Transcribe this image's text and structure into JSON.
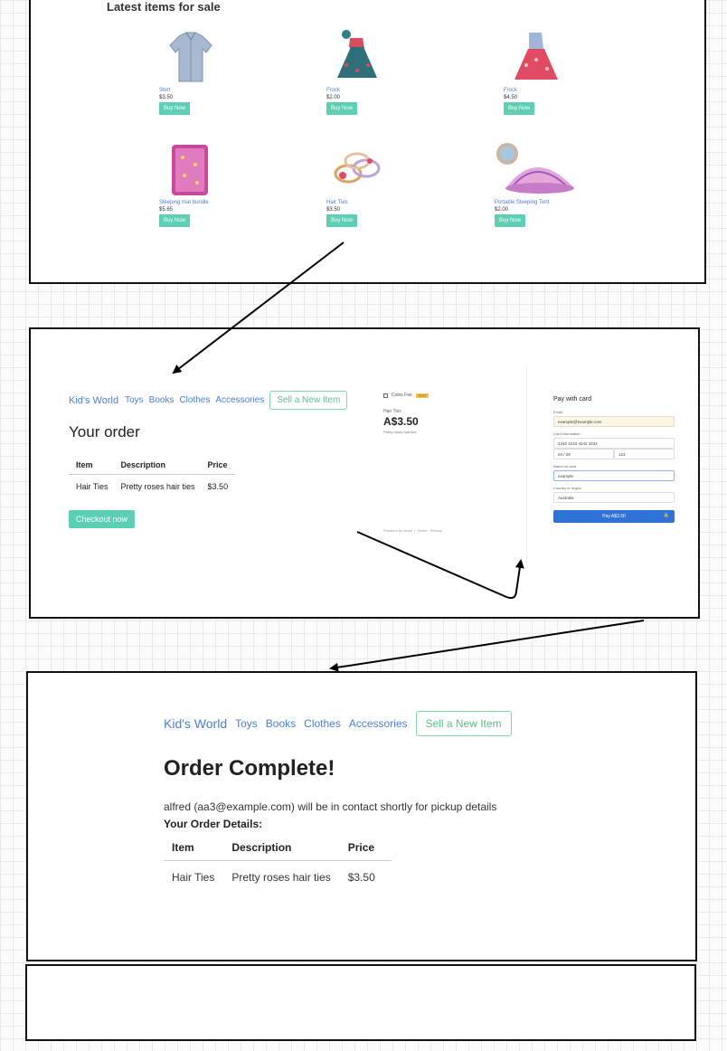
{
  "panel1": {
    "title": "Latest items for sale",
    "products": [
      {
        "name": "Shirt",
        "price": "$3.50",
        "button": "Buy Now"
      },
      {
        "name": "Frock",
        "price": "$2.00",
        "button": "Buy Now"
      },
      {
        "name": "Frock",
        "price": "$4.50",
        "button": "Buy Now"
      },
      {
        "name": "Sleeping mat bundle",
        "price": "$5.65",
        "button": "Buy Now"
      },
      {
        "name": "Hair Ties",
        "price": "$3.50",
        "button": "Buy Now"
      },
      {
        "name": "Portable Sleeping Tent",
        "price": "$2.00",
        "button": "Buy Now"
      }
    ]
  },
  "panel2": {
    "nav": {
      "brand": "Kid's World",
      "links": [
        "Toys",
        "Books",
        "Clothes",
        "Accessories"
      ],
      "sell": "Sell a New Item"
    },
    "title": "Your order",
    "table": {
      "headers": [
        "Item",
        "Description",
        "Price"
      ],
      "rows": [
        [
          "Hair Ties",
          "Pretty roses hair ties",
          "$3.50"
        ]
      ]
    },
    "checkout": "Checkout now",
    "stripe": {
      "business": "Coles Fee",
      "test_badge": "TEST",
      "item": "Hair Ties",
      "amount": "A$3.50",
      "description": "Pretty roses hair ties",
      "footer_powered": "Powered by stripe",
      "footer_terms": "Terms",
      "footer_privacy": "Privacy",
      "heading": "Pay with card",
      "email_label": "Email",
      "email_value": "example@example.com",
      "card_label": "Card information",
      "card_number": "4242 4242 4242 4242",
      "card_expiry": "04 / 29",
      "card_cvc": "123",
      "name_label": "Name on card",
      "name_value": "example",
      "country_label": "Country or region",
      "country_value": "Australia",
      "pay_button": "Pay A$3.50"
    }
  },
  "panel3": {
    "nav": {
      "brand": "Kid's World",
      "links": [
        "Toys",
        "Books",
        "Clothes",
        "Accessories"
      ],
      "sell": "Sell a New Item"
    },
    "title": "Order Complete!",
    "contact": "alfred (aa3@example.com) will be in contact shortly for pickup details",
    "details_heading": "Your Order Details:",
    "table": {
      "headers": [
        "Item",
        "Description",
        "Price"
      ],
      "rows": [
        [
          "Hair Ties",
          "Pretty roses hair ties",
          "$3.50"
        ]
      ]
    }
  }
}
